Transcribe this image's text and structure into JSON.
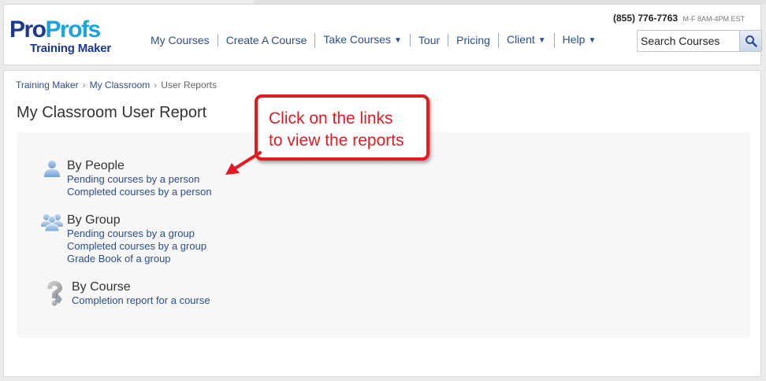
{
  "header": {
    "logo_pro": "Pro",
    "logo_profs": "Profs",
    "logo_sub": "Training Maker",
    "phone_number": "(855) 776-7763",
    "phone_hours": "M-F 8AM-4PM EST",
    "nav": [
      {
        "label": "My Courses"
      },
      {
        "label": "Create A Course"
      },
      {
        "label": "Take Courses",
        "caret": "▼"
      },
      {
        "label": "Tour"
      },
      {
        "label": "Pricing"
      },
      {
        "label": "Client",
        "caret": "▼"
      },
      {
        "label": "Help",
        "caret": "▼"
      }
    ],
    "search_placeholder": "Search Courses"
  },
  "breadcrumb": {
    "items": [
      "Training Maker",
      "My Classroom"
    ],
    "current": "User Reports",
    "separator": "›"
  },
  "page_title": "My Classroom User Report",
  "sections": [
    {
      "title": "By People",
      "icon": "person-icon",
      "links": [
        "Pending courses by a person",
        "Completed courses by a person"
      ]
    },
    {
      "title": "By Group",
      "icon": "group-icon",
      "links": [
        "Pending courses by a group",
        "Completed courses by a group",
        "Grade Book of a group"
      ]
    },
    {
      "title": "By Course",
      "icon": "question-icon",
      "links": [
        "Completion report for a course"
      ]
    }
  ],
  "callout": {
    "line1": "Click on the links",
    "line2": "to view the reports"
  },
  "colors": {
    "link": "#2c4e8c",
    "callout_red": "#e21b23",
    "logo_dark_blue": "#1b3a8f",
    "logo_light_blue": "#1aa3dd"
  }
}
